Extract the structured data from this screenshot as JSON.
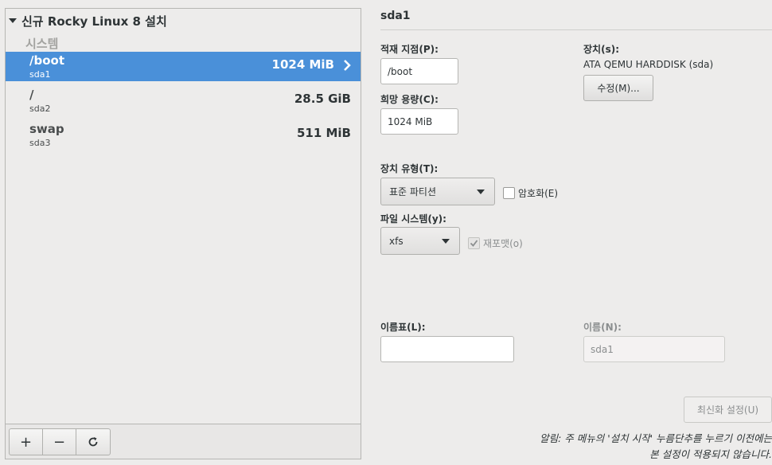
{
  "left": {
    "header": "신규 Rocky Linux 8 설치",
    "section": "시스템",
    "items": [
      {
        "mount": "/boot",
        "device": "sda1",
        "size": "1024 MiB",
        "selected": true
      },
      {
        "mount": "/",
        "device": "sda2",
        "size": "28.5 GiB",
        "selected": false
      },
      {
        "mount": "swap",
        "device": "sda3",
        "size": "511 MiB",
        "selected": false
      }
    ],
    "toolbar": {
      "add": "+",
      "remove": "−",
      "refresh": "↻"
    }
  },
  "right": {
    "title": "sda1",
    "mount_point_label": "적재 지점(P):",
    "mount_point_value": "/boot",
    "capacity_label": "희망 용량(C):",
    "capacity_value": "1024 MiB",
    "devices_label": "장치(s):",
    "devices_value": "ATA QEMU HARDDISK (sda)",
    "modify_button": "수정(M)...",
    "device_type_label": "장치 유형(T):",
    "device_type_value": "표준 파티션",
    "encrypt_label": "암호화(E)",
    "filesystem_label": "파일 시스템(y):",
    "filesystem_value": "xfs",
    "reformat_label": "재포맷(o)",
    "label_label": "이름표(L):",
    "label_value": "",
    "name_label": "이름(N):",
    "name_value": "sda1",
    "update_button": "최신화 설정(U)",
    "note_line1": "알림: 주 메뉴의 '설치 시작' 누름단추를 누르기 이전에는",
    "note_line2": "본 설정이 적용되지 않습니다."
  },
  "colors": {
    "selection": "#4a90d9",
    "background": "#edeceb"
  }
}
